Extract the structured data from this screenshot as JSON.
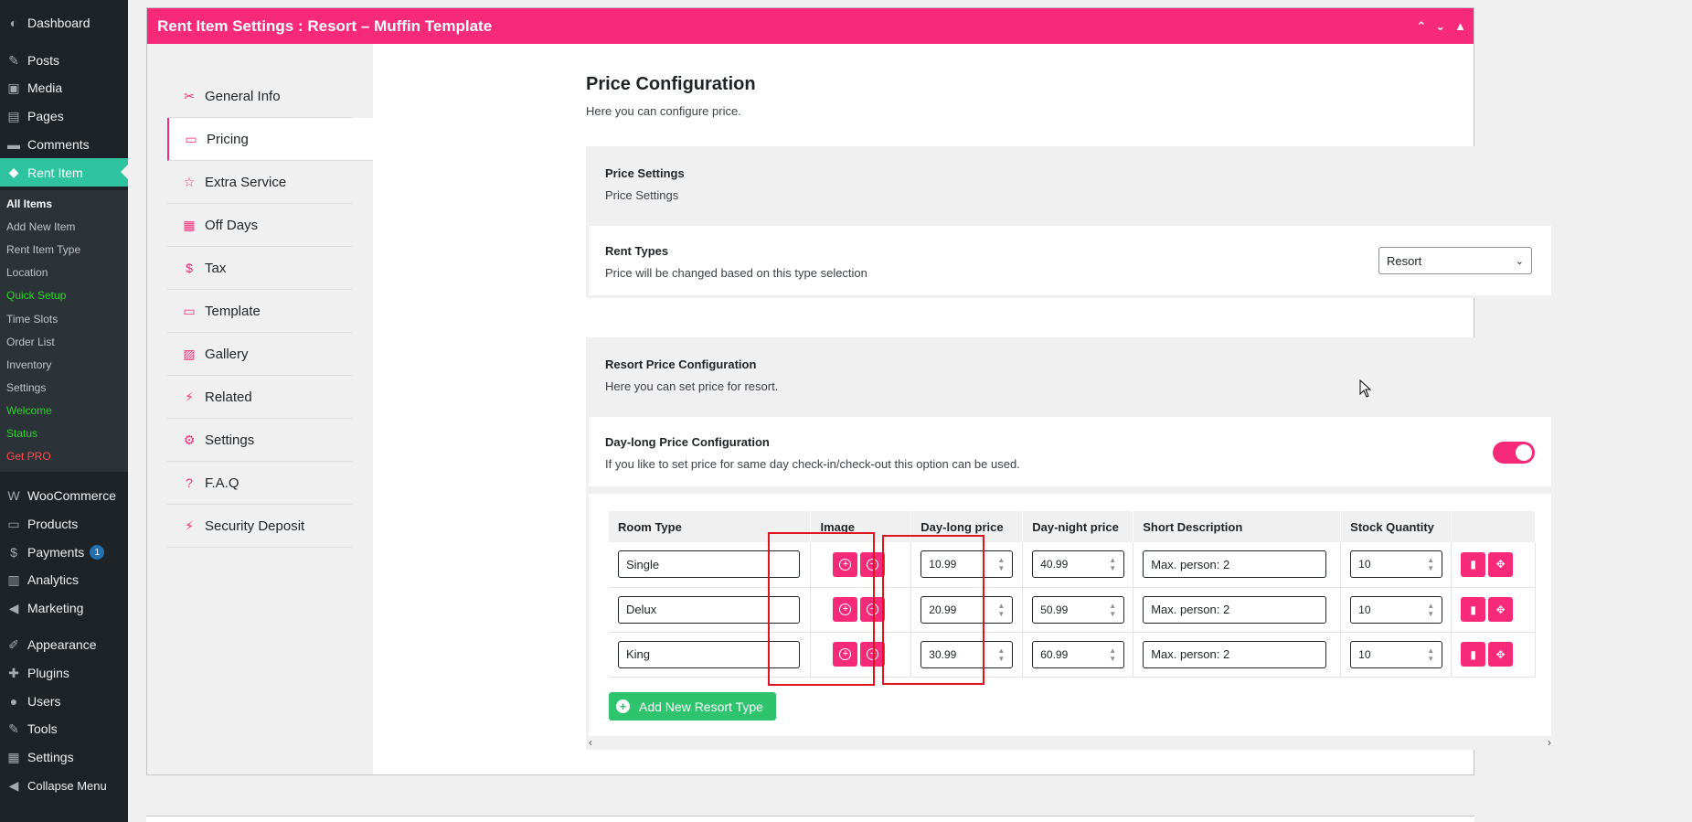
{
  "sidebar": {
    "top": [
      {
        "label": "Dashboard",
        "icon": "dashboard-icon"
      },
      {
        "label": "Posts",
        "icon": "pin-icon"
      },
      {
        "label": "Media",
        "icon": "media-icon"
      },
      {
        "label": "Pages",
        "icon": "pages-icon"
      },
      {
        "label": "Comments",
        "icon": "comments-icon"
      },
      {
        "label": "Rent Item",
        "icon": "tag-icon"
      }
    ],
    "submenu": [
      "All Items",
      "Add New Item",
      "Rent Item Type",
      "Location",
      "Quick Setup",
      "Time Slots",
      "Order List",
      "Inventory",
      "Settings",
      "Welcome",
      "Status",
      "Get PRO"
    ],
    "bottom": [
      {
        "label": "WooCommerce",
        "icon": "woo-icon"
      },
      {
        "label": "Products",
        "icon": "products-icon"
      },
      {
        "label": "Payments",
        "icon": "payments-icon",
        "badge": "1"
      },
      {
        "label": "Analytics",
        "icon": "analytics-icon"
      },
      {
        "label": "Marketing",
        "icon": "marketing-icon"
      },
      {
        "label": "Appearance",
        "icon": "brush-icon"
      },
      {
        "label": "Plugins",
        "icon": "plugin-icon"
      },
      {
        "label": "Users",
        "icon": "users-icon"
      },
      {
        "label": "Tools",
        "icon": "tools-icon"
      },
      {
        "label": "Settings",
        "icon": "settings-icon"
      },
      {
        "label": "Collapse Menu",
        "icon": "collapse-icon"
      }
    ]
  },
  "panel": {
    "title": "Rent Item Settings : Resort – Muffin Template",
    "controls": [
      "▲",
      "▼",
      "▲"
    ]
  },
  "tabs": [
    {
      "label": "General Info",
      "icon": "tools-icon"
    },
    {
      "label": "Pricing",
      "icon": "card-icon"
    },
    {
      "label": "Extra Service",
      "icon": "star-icon"
    },
    {
      "label": "Off Days",
      "icon": "calendar-icon"
    },
    {
      "label": "Tax",
      "icon": "dollar-icon"
    },
    {
      "label": "Template",
      "icon": "card-icon"
    },
    {
      "label": "Gallery",
      "icon": "gallery-icon"
    },
    {
      "label": "Related",
      "icon": "plug-icon"
    },
    {
      "label": "Settings",
      "icon": "gear-icon"
    },
    {
      "label": "F.A.Q",
      "icon": "question-icon"
    },
    {
      "label": "Security Deposit",
      "icon": "plug-icon"
    }
  ],
  "content": {
    "title": "Price Configuration",
    "subtitle": "Here you can configure price.",
    "price_settings": {
      "title": "Price Settings",
      "desc": "Price Settings"
    },
    "rent_types": {
      "title": "Rent Types",
      "desc": "Price will be changed based on this type selection",
      "selected": "Resort"
    },
    "resort": {
      "title": "Resort Price Configuration",
      "desc": "Here you can set price for resort."
    },
    "daylong": {
      "title": "Day-long Price Configuration",
      "desc": "If you like to set price for same day check-in/check-out this option can be used."
    },
    "table": {
      "headers": [
        "Room Type",
        "Image",
        "Day-long price",
        "Day-night price",
        "Short Description",
        "Stock Quantity"
      ],
      "rows": [
        {
          "room": "Single",
          "daylong": "10.99",
          "daynight": "40.99",
          "desc": "Max. person: 2",
          "stock": "10"
        },
        {
          "room": "Delux",
          "daylong": "20.99",
          "daynight": "50.99",
          "desc": "Max. person: 2",
          "stock": "10"
        },
        {
          "room": "King",
          "daylong": "30.99",
          "daynight": "60.99",
          "desc": "Max. person: 2",
          "stock": "10"
        }
      ]
    },
    "add_button": "Add New Resort Type"
  },
  "colors": {
    "accent": "#f72a7a",
    "sidebar": "#1d2327",
    "current": "#2ec4a0",
    "add": "#2ec46d",
    "highlight": "#e0141e"
  }
}
